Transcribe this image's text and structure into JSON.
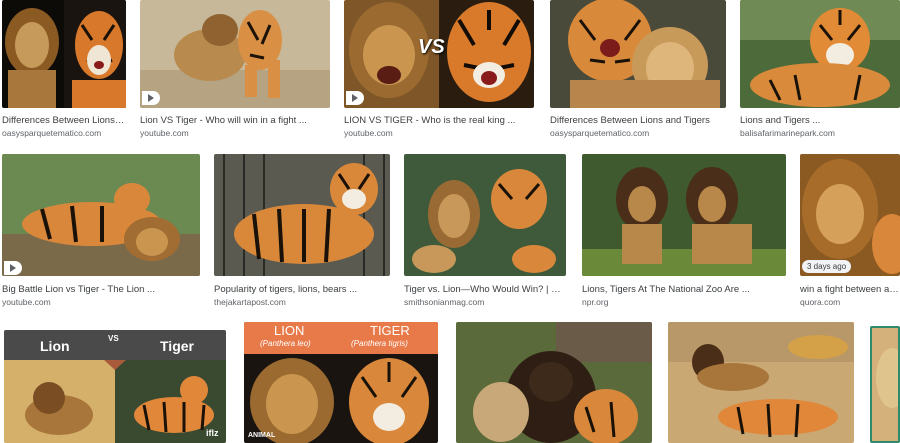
{
  "results": [
    {
      "title": "Differences Between Lions a...",
      "source": "oasysparquetematico.com"
    },
    {
      "title": "Lion VS Tiger - Who will win in a fight ...",
      "source": "youtube.com",
      "video": true
    },
    {
      "title": "LION VS TIGER - Who is the real king ...",
      "source": "youtube.com",
      "video": true,
      "overlay": "VS"
    },
    {
      "title": "Differences Between Lions and Tigers",
      "source": "oasysparquetematico.com"
    },
    {
      "title": "Lions and Tigers ...",
      "source": "balisafarimarinepark.com"
    },
    {
      "title": "Big Battle Lion vs Tiger - The Lion ...",
      "source": "youtube.com",
      "video": true
    },
    {
      "title": "Popularity of tigers, lions, bears ...",
      "source": "thejakartapost.com"
    },
    {
      "title": "Tiger vs. Lion—Who Would Win? | Smar...",
      "source": "smithsonianmag.com"
    },
    {
      "title": "Lions, Tigers At The National Zoo Are ...",
      "source": "npr.org"
    },
    {
      "title": "win a fight between a tig...",
      "source": "quora.com",
      "badge": "3 days ago"
    },
    {
      "banner_left": "Lion",
      "banner_vs": "VS",
      "banner_right": "Tiger",
      "watermark": "iflz"
    },
    {
      "banner_left": "LION",
      "banner_left_sub": "(Panthera leo)",
      "banner_right": "TIGER",
      "banner_right_sub": "(Panthera tigris)",
      "watermark": "ANIMAL"
    },
    {},
    {},
    {}
  ]
}
